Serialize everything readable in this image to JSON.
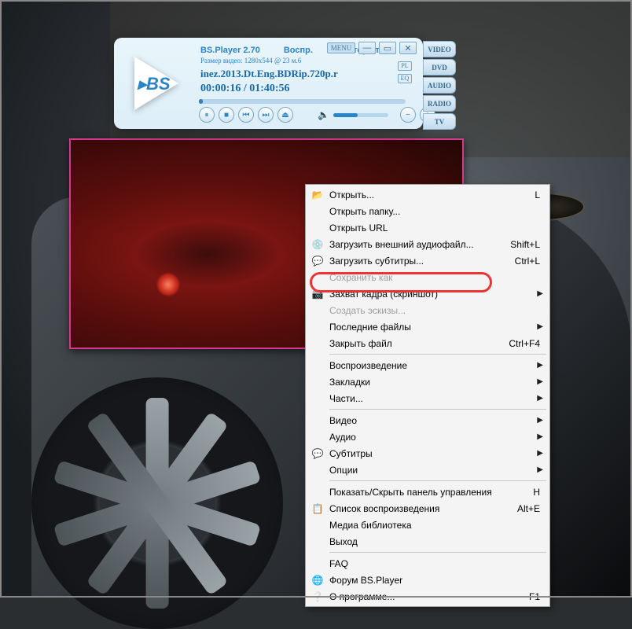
{
  "player": {
    "app_title": "BS.Player 2.70",
    "status": "Воспр.",
    "repeat": "Повтор откл",
    "video_size_label": "Размер видео: 1280x544 @ 23 м.6",
    "file_title": "inez.2013.Dt.Eng.BDRip.720p.r",
    "time": "00:00:16 / 01:40:56",
    "menu_btn": "MENU",
    "pl_badge": "PL",
    "eq_badge": "EQ",
    "logo_text": "▸BS"
  },
  "right_tabs": [
    "VIDEO",
    "DVD",
    "AUDIO",
    "RADIO",
    "TV"
  ],
  "menu": {
    "items": [
      {
        "icon": "📂",
        "label": "Открыть...",
        "shortcut": "L"
      },
      {
        "icon": "",
        "label": "Открыть папку..."
      },
      {
        "icon": "",
        "label": "Открыть URL"
      },
      {
        "icon": "💿",
        "label": "Загрузить внешний аудиофайл...",
        "shortcut": "Shift+L"
      },
      {
        "icon": "💬",
        "label": "Загрузить субтитры...",
        "shortcut": "Ctrl+L"
      },
      {
        "icon": "",
        "label": "Сохранить как",
        "disabled": true
      },
      {
        "icon": "📷",
        "label": "Захват кадра (скриншот)",
        "arrow": true,
        "hl": true
      },
      {
        "icon": "",
        "label": "Создать эскизы...",
        "disabled": true
      },
      {
        "icon": "",
        "label": "Последние файлы",
        "arrow": true
      },
      {
        "icon": "",
        "label": "Закрыть файл",
        "shortcut": "Ctrl+F4"
      },
      {
        "sep": true
      },
      {
        "icon": "",
        "label": "Воспроизведение",
        "arrow": true
      },
      {
        "icon": "",
        "label": "Закладки",
        "arrow": true
      },
      {
        "icon": "",
        "label": "Части...",
        "arrow": true
      },
      {
        "sep": true
      },
      {
        "icon": "",
        "label": "Видео",
        "arrow": true
      },
      {
        "icon": "",
        "label": "Аудио",
        "arrow": true
      },
      {
        "icon": "💬",
        "label": "Субтитры",
        "arrow": true
      },
      {
        "icon": "",
        "label": "Опции",
        "arrow": true
      },
      {
        "sep": true
      },
      {
        "icon": "",
        "label": "Показать/Скрыть панель управления",
        "shortcut": "H"
      },
      {
        "icon": "📋",
        "label": "Список воспроизведения",
        "shortcut": "Alt+E"
      },
      {
        "icon": "",
        "label": "Медиа библиотека"
      },
      {
        "icon": "",
        "label": "Выход"
      },
      {
        "sep": true
      },
      {
        "icon": "",
        "label": "FAQ"
      },
      {
        "icon": "🌐",
        "label": "Форум BS.Player"
      },
      {
        "icon": "❔",
        "label": "О программе...",
        "shortcut": "F1"
      }
    ]
  }
}
